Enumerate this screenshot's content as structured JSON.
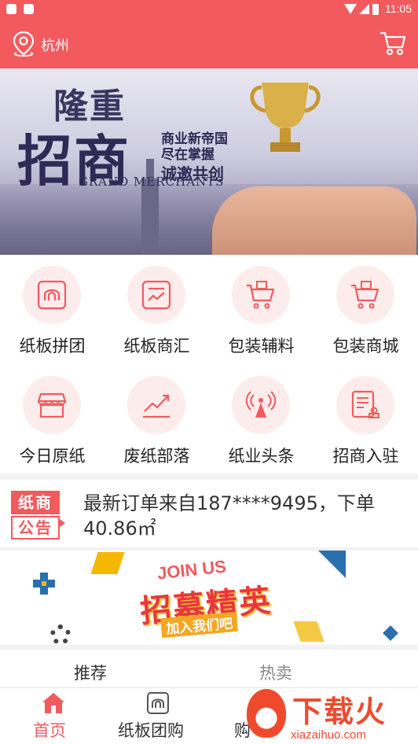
{
  "status_bar": {
    "time": "11:05"
  },
  "header": {
    "city": "杭州",
    "location_icon": "location-pin-icon",
    "cart_icon": "shopping-cart-icon",
    "accent_color": "#f25a5e"
  },
  "banner": {
    "title_line1": "隆重",
    "title_line2": "招商",
    "subtitle": "GRAND MERCHANTS",
    "slogan_line1": "商业新帝国",
    "slogan_line2": "尽在掌握",
    "slogan_line3": "诚邀共创"
  },
  "menu": {
    "items": [
      {
        "label": "纸板拼团",
        "icon": "cardboard-group-icon"
      },
      {
        "label": "纸板商汇",
        "icon": "cardboard-chart-icon"
      },
      {
        "label": "包装辅料",
        "icon": "cart-icon"
      },
      {
        "label": "包装商城",
        "icon": "cart-icon"
      },
      {
        "label": "今日原纸",
        "icon": "store-icon"
      },
      {
        "label": "废纸部落",
        "icon": "trend-chart-icon"
      },
      {
        "label": "纸业头条",
        "icon": "broadcast-icon"
      },
      {
        "label": "招商入驻",
        "icon": "document-stamp-icon"
      }
    ]
  },
  "notice": {
    "logo_line1": "纸商",
    "logo_line2": "公告",
    "message": "最新订单来自187****9495，下单40.86㎡"
  },
  "recruit_banner": {
    "join_us": "JOIN US",
    "title": "招募精英",
    "subtitle": "加入我们吧"
  },
  "tabs": [
    {
      "label": "推荐",
      "active": true
    },
    {
      "label": "热卖",
      "active": false
    }
  ],
  "bottom_nav": [
    {
      "label": "首页",
      "icon": "home-icon",
      "active": true
    },
    {
      "label": "纸板团购",
      "icon": "cardboard-icon",
      "active": false
    },
    {
      "label": "购",
      "icon": "",
      "active": false
    }
  ],
  "watermark": {
    "text": "下载火",
    "url": "xiazaihuo.com"
  }
}
